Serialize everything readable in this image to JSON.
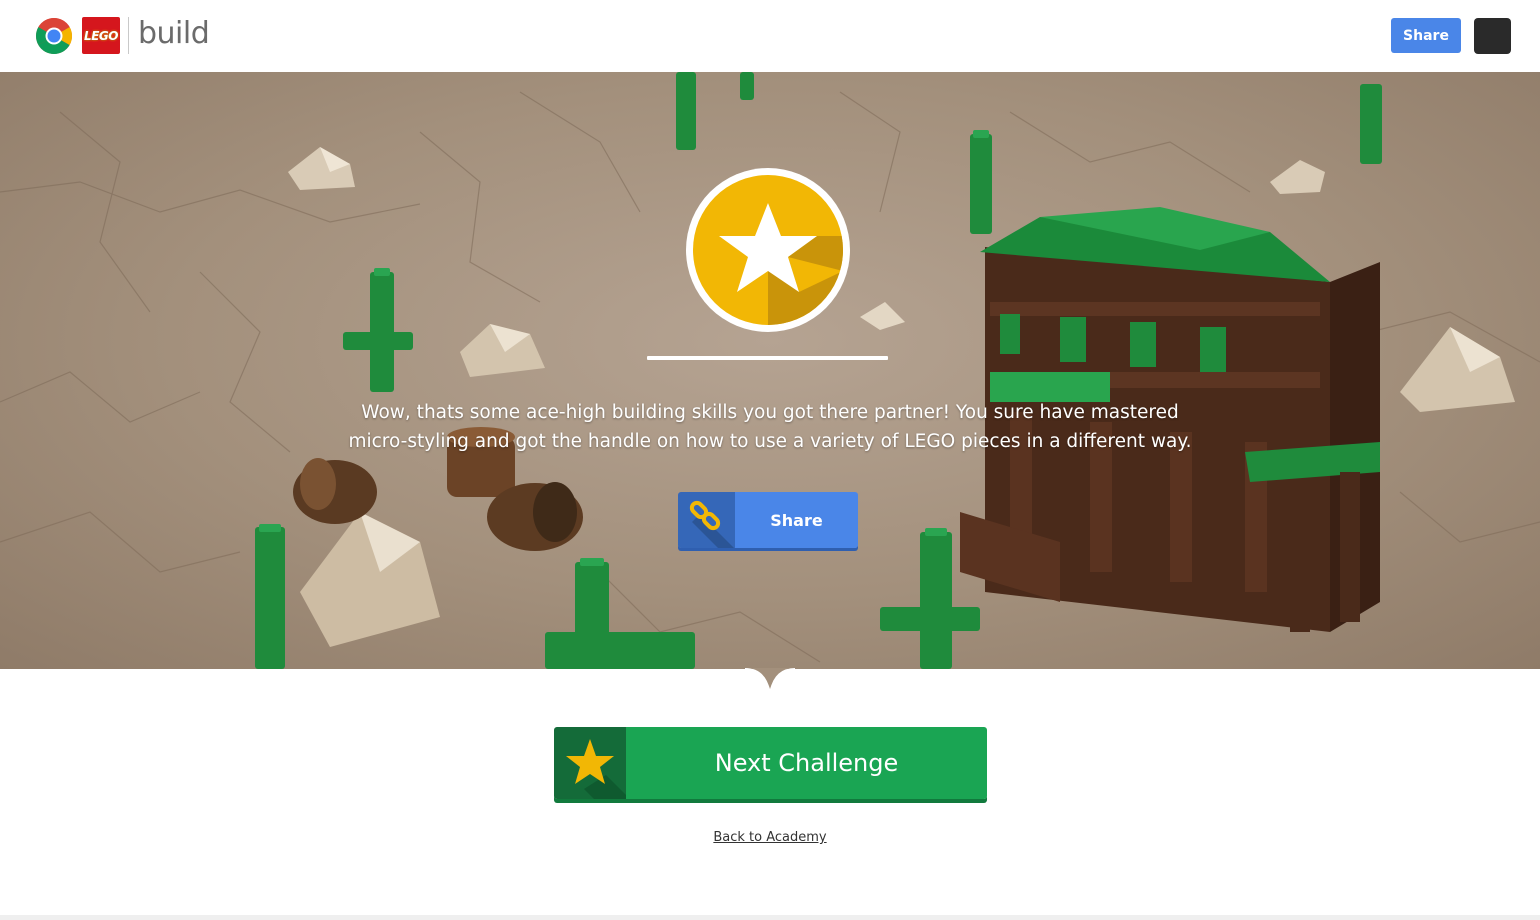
{
  "header": {
    "brand_logo_text": "LEGO",
    "brand_word": "build",
    "share_label": "Share",
    "icons": [
      "chrome-logo",
      "lego-logo",
      "menu-icon"
    ]
  },
  "hero": {
    "message": "Wow, thats some ace-high building skills you got there partner! You sure have mastered micro-styling and got the handle on how to use a variety of LEGO pieces in a different way.",
    "share_label": "Share",
    "badge_icon": "star-icon",
    "share_icon": "link-icon"
  },
  "actions": {
    "next_challenge_label": "Next Challenge",
    "next_challenge_icon": "star-icon",
    "back_link_label": "Back to Academy"
  },
  "colors": {
    "share_blue": "#4a86e8",
    "next_green": "#1aa553",
    "badge_gold": "#f2b705",
    "lego_red": "#d5161d"
  }
}
